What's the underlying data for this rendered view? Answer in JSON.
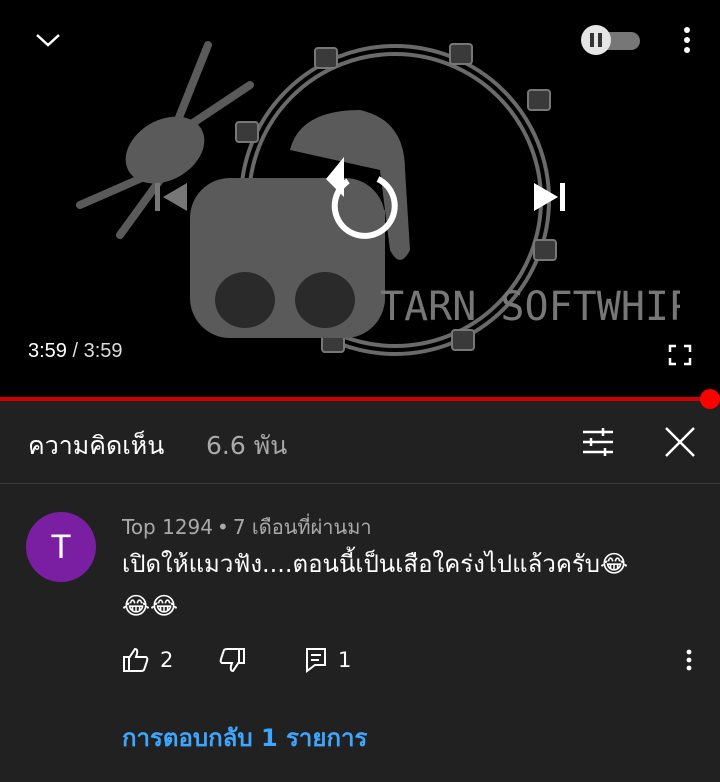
{
  "player": {
    "current_time": "3:59",
    "separator": " / ",
    "duration": "3:59",
    "progress": 1.0,
    "artwork_text": "TARN SOFTWHIP",
    "autoplay_state": "on"
  },
  "comments": {
    "title": "ความคิดเห็น",
    "count": "6.6 พัน"
  },
  "comment": {
    "avatar_letter": "T",
    "author": "Top 1294",
    "dot": "•",
    "time": "7 เดือนที่ผ่านมา",
    "text": "เปิดให้แมวฟัง....ตอนนี้เป็นเสือใคร่งไปแล้วครับ",
    "emoji_inline": "😂",
    "emoji_line": "😂😂",
    "likes": "2",
    "reply_count": "1",
    "replies_label": "การตอบกลับ 1 รายการ"
  },
  "colors": {
    "accent_red": "#ff0000",
    "avatar": "#7b1fa2",
    "link": "#3ea6ff"
  },
  "icons": [
    "chevron-down-icon",
    "pause-icon",
    "more-vert-icon",
    "replay-icon",
    "previous-icon",
    "skip-next-icon",
    "fullscreen-icon",
    "filter-icon",
    "close-icon",
    "thumb-up-icon",
    "thumb-down-icon",
    "comment-icon"
  ]
}
